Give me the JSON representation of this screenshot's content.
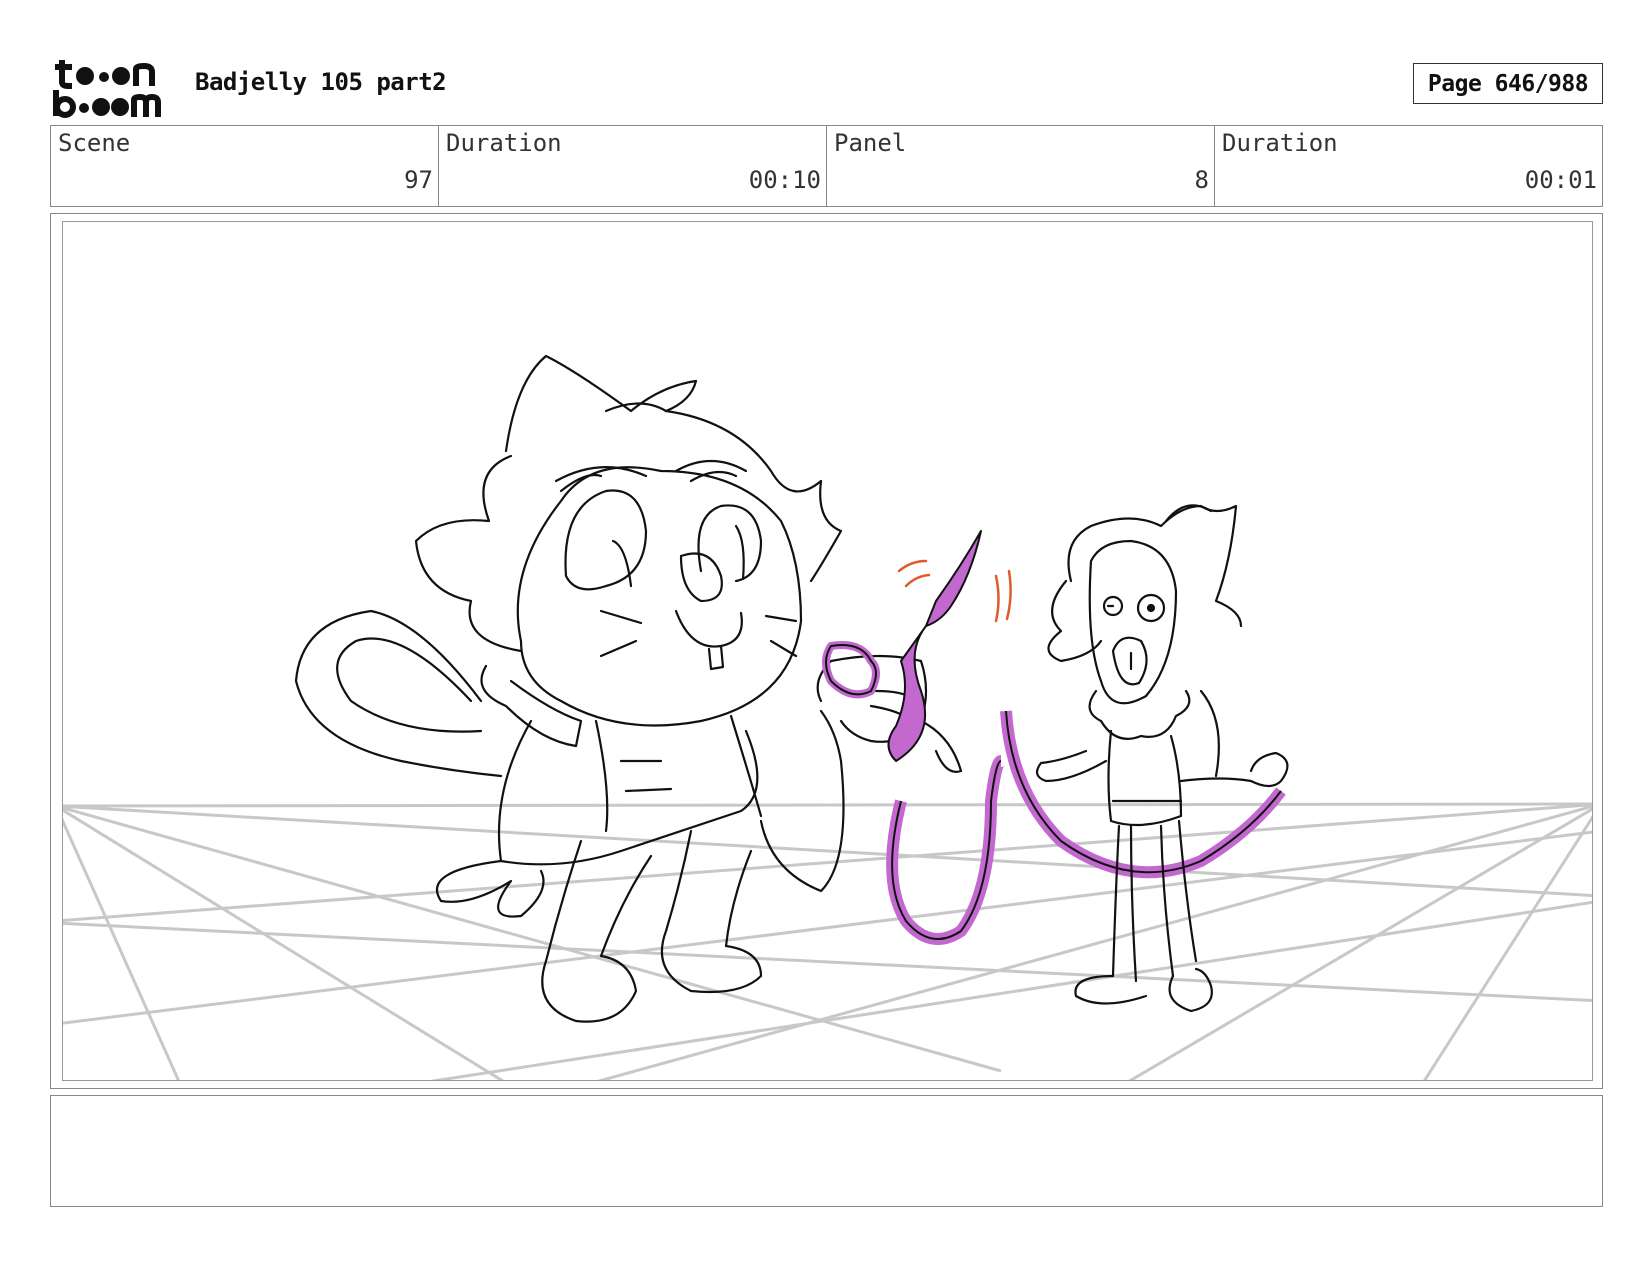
{
  "header": {
    "logo_icon": "toon-boom-logo",
    "project_title": "Badjelly 105 part2",
    "page_label": "Page 646/988"
  },
  "info": {
    "scene_label": "Scene",
    "scene_value": "97",
    "scene_duration_label": "Duration",
    "scene_duration_value": "00:10",
    "panel_label": "Panel",
    "panel_value": "8",
    "panel_duration_label": "Duration",
    "panel_duration_value": "00:01"
  },
  "panel_image": {
    "icon": "storyboard-sketch",
    "accent_colors": {
      "scissors_and_ribbon": "#c268cf",
      "motion_marks": "#e05a2b",
      "perspective_grid": "#c8c8c8"
    }
  },
  "notes": {
    "text": ""
  }
}
